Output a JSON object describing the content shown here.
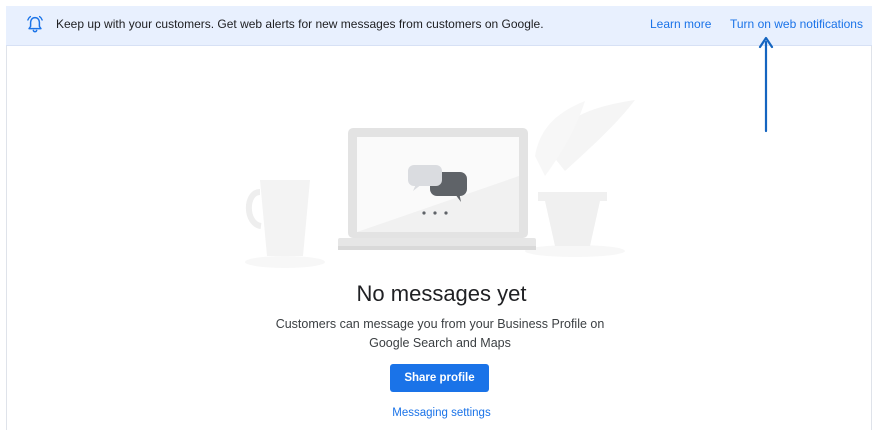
{
  "banner": {
    "icon": "bell-alert-icon",
    "message": "Keep up with your customers. Get web alerts for new messages from customers on Google.",
    "learn_more": "Learn more",
    "turn_on": "Turn on web notifications"
  },
  "empty_state": {
    "illustration": "laptop-chat-bubbles-illustration",
    "title": "No messages yet",
    "description": "Customers can message you from your Business Profile on Google Search and Maps",
    "share_button": "Share profile",
    "settings_link": "Messaging settings"
  },
  "colors": {
    "accent": "#1a73e8",
    "banner_bg": "#e8f0fe",
    "arrow": "#1565c0"
  }
}
